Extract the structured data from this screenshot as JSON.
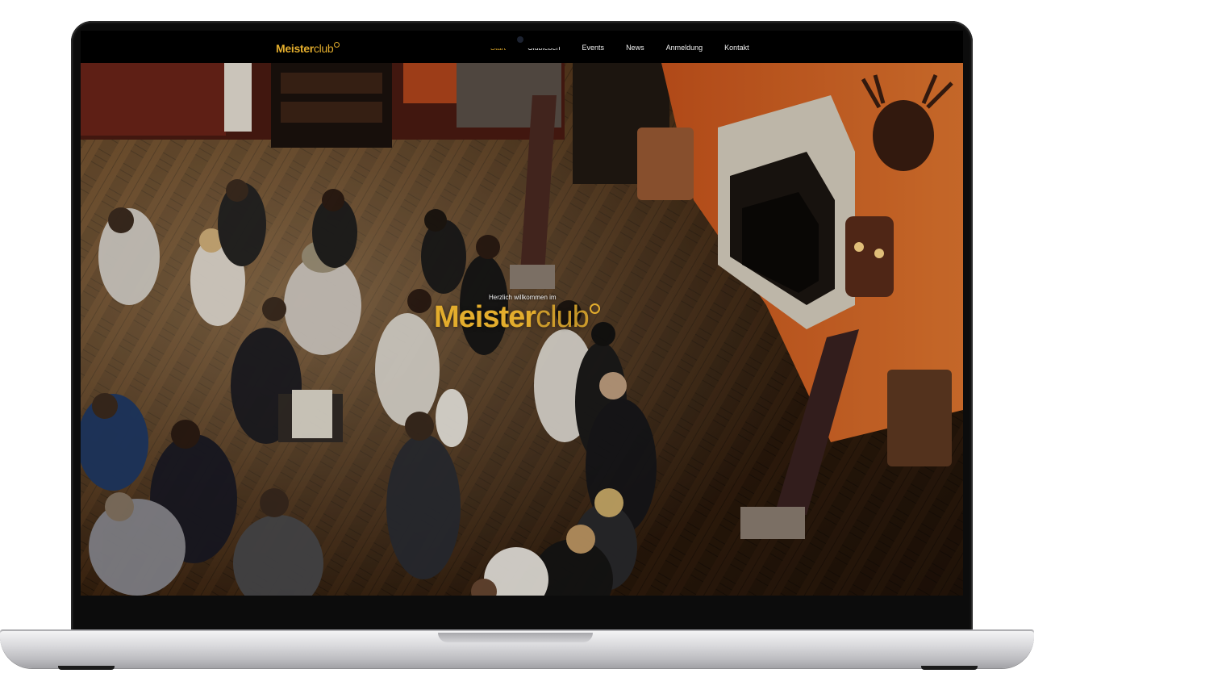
{
  "site": {
    "logo_main": "Meister",
    "logo_accent": "club",
    "nav": [
      {
        "label": "Start",
        "active": true
      },
      {
        "label": "Clubleben",
        "active": false
      },
      {
        "label": "Events",
        "active": false
      },
      {
        "label": "News",
        "active": false
      },
      {
        "label": "Anmeldung",
        "active": false
      },
      {
        "label": "Kontakt",
        "active": false
      }
    ]
  },
  "hero": {
    "subtitle": "Herzlich willkommen im",
    "title_main": "Meister",
    "title_accent": "club"
  },
  "colors": {
    "brand_gold": "#e3ad2d",
    "header_bg": "#000000",
    "laptop_frame": "#0c0c0c",
    "laptop_base": "#d9d9dc"
  }
}
